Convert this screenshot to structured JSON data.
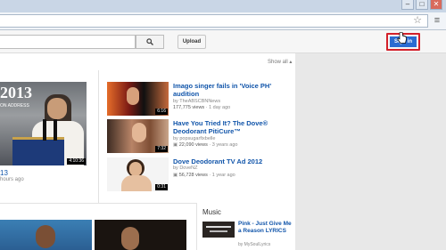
{
  "browser": {
    "window_buttons": [
      "–",
      "□",
      "✕"
    ],
    "star_icon": "star-icon",
    "menu_icon": "wrench-icon"
  },
  "header": {
    "search_icon": "search-icon",
    "upload_label": "Upload",
    "signin_label": "Sign in"
  },
  "main": {
    "show_all_label": "Show all",
    "featured": {
      "thumb_year_text": "2013",
      "thumb_caption": "ON ADDRESS",
      "duration": "4:10:36",
      "title_fragment": "13",
      "meta_fragment": "hours ago"
    },
    "videos": [
      {
        "title": "Imago singer fails in 'Voice PH' audition",
        "by": "by TheABSCBNNews",
        "views": "177,775 views",
        "age": "1 day ago",
        "duration": "6:16"
      },
      {
        "title": "Have You Tried It? The Dove® Deodorant PitiCure™",
        "by": "by popsugarfixbelle",
        "views": "22,090 views",
        "age": "3 years ago",
        "duration": "7:32"
      },
      {
        "title": "Dove Deodorant TV Ad 2012",
        "by": "by DoveNZ",
        "views": "56,728 views",
        "age": "1 year ago",
        "duration": "0:31"
      }
    ]
  },
  "sidebar": {
    "section_title": "Music",
    "item": {
      "title": "Pink - Just Give Me a Reason LYRICS",
      "by": "by MySoulLyrics"
    }
  },
  "colors": {
    "link": "#1155aa",
    "signin_bg": "#2a6bd1",
    "highlight": "#d3202a"
  }
}
